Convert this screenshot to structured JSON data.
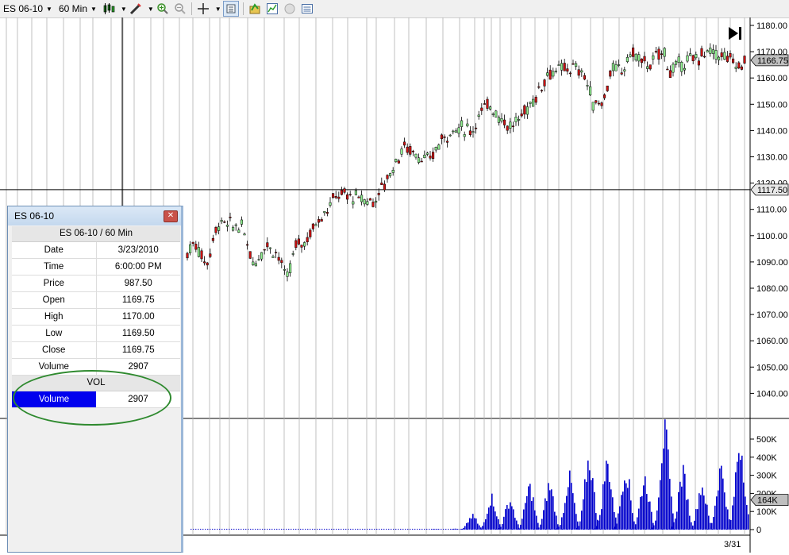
{
  "toolbar": {
    "instrument": "ES 06-10",
    "interval": "60 Min",
    "icons": [
      "candlestick-style-icon",
      "drawing-pencil-icon",
      "zoom-in-icon",
      "zoom-out-icon",
      "crosshair-icon",
      "data-box-icon",
      "instrument-icon",
      "chart-properties-icon",
      "indicator-icon",
      "strategy-list-icon"
    ]
  },
  "chart": {
    "price_labels": [
      "1180.00",
      "1170.00",
      "1160.00",
      "1150.00",
      "1140.00",
      "1130.00",
      "1120.00",
      "1110.00",
      "1100.00",
      "1090.00",
      "1080.00",
      "1070.00",
      "1060.00",
      "1050.00",
      "1040.00"
    ],
    "last_price": "1166.75",
    "cursor_price": "1117.50",
    "volume_labels": [
      "500K",
      "400K",
      "300K",
      "200K",
      "100K",
      "0"
    ],
    "last_volume": "164K",
    "date_label": "3/31",
    "colors": {
      "up": "#90ee90",
      "down": "#cc1111",
      "volume": "#0000cc"
    }
  },
  "data_window": {
    "title": "ES 06-10",
    "header": "ES 06-10 / 60 Min",
    "rows": [
      {
        "label": "Date",
        "value": "3/23/2010"
      },
      {
        "label": "Time",
        "value": "6:00:00 PM"
      },
      {
        "label": "Price",
        "value": "987.50"
      },
      {
        "label": "Open",
        "value": "1169.75"
      },
      {
        "label": "High",
        "value": "1170.00"
      },
      {
        "label": "Low",
        "value": "1169.50"
      },
      {
        "label": "Close",
        "value": "1169.75"
      },
      {
        "label": "Volume",
        "value": "2907"
      }
    ],
    "sub_header": "VOL",
    "vol_row": {
      "label": "Volume",
      "value": "2907"
    }
  }
}
